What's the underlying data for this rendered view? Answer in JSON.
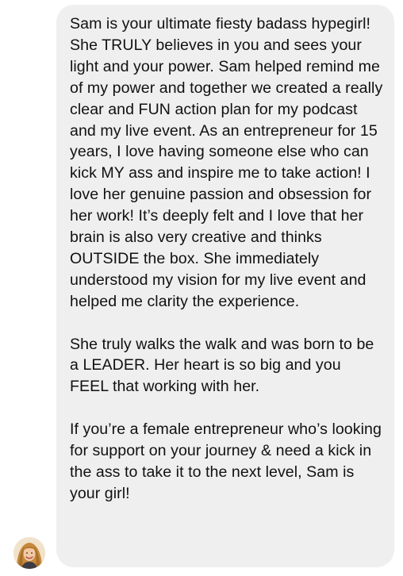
{
  "message": {
    "paragraphs": [
      "Sam is your ultimate fiesty badass hypegirl! She TRULY believes in you and sees your light and your power. Sam helped remind me of my power and together we created a really clear and FUN action plan for my podcast and my live event. As an entrepreneur for 15 years, I love having someone else who can kick MY ass and inspire me to take action! I love her genuine passion and obsession for her work! It’s deeply felt and I love that her brain is also very creative and thinks OUTSIDE the box. She immediately understood my vision for my live event and helped me clarity the experience.",
      "She truly walks the walk and was born to be a LEADER. Her heart is so big and you FEEL that working with her.",
      "If you’re a female entrepreneur who’s looking for support on your journey & need a kick in the ass to take it to the next level, Sam is your girl!"
    ]
  },
  "colors": {
    "bubble": "#efefef",
    "text": "#111111",
    "background": "#ffffff"
  },
  "icons": {
    "avatar": "sender-avatar-photo"
  }
}
